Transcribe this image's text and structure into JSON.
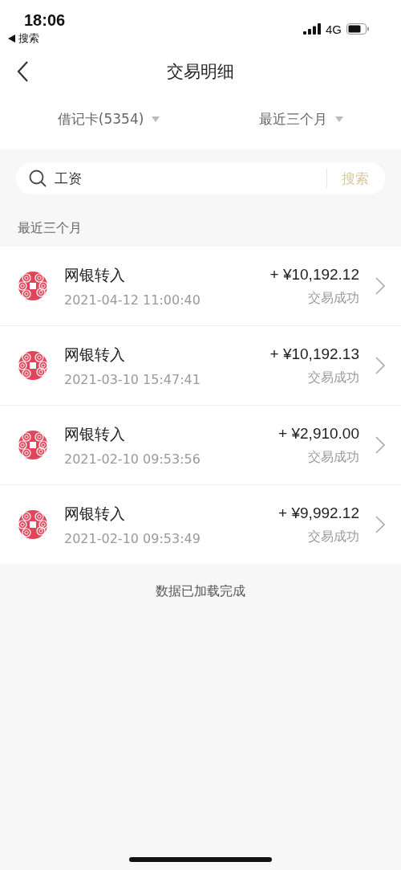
{
  "status_bar": {
    "time": "18:06",
    "back_app": "搜索",
    "network": "4G"
  },
  "nav": {
    "title": "交易明细"
  },
  "filters": [
    {
      "label": "借记卡(5354)"
    },
    {
      "label": "最近三个月"
    }
  ],
  "search": {
    "value": "工资",
    "button": "搜索"
  },
  "section_title": "最近三个月",
  "transactions": [
    {
      "title": "网银转入",
      "time": "2021-04-12 11:00:40",
      "amount": "+ ¥10,192.12",
      "status": "交易成功"
    },
    {
      "title": "网银转入",
      "time": "2021-03-10 15:47:41",
      "amount": "+ ¥10,192.13",
      "status": "交易成功"
    },
    {
      "title": "网银转入",
      "time": "2021-02-10 09:53:56",
      "amount": "+ ¥2,910.00",
      "status": "交易成功"
    },
    {
      "title": "网银转入",
      "time": "2021-02-10 09:53:49",
      "amount": "+ ¥9,992.12",
      "status": "交易成功"
    }
  ],
  "footer": "数据已加载完成"
}
